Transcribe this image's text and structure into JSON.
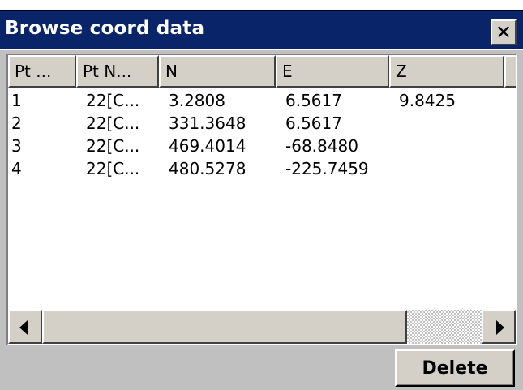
{
  "window": {
    "title": "Browse coord data",
    "close_glyph": "✕"
  },
  "table": {
    "columns": [
      "Pt ...",
      "Pt N...",
      "N",
      "E",
      "Z"
    ],
    "rows": [
      [
        "1",
        "22[C...",
        "3.2808",
        "6.5617",
        "9.8425"
      ],
      [
        "2",
        "22[C...",
        "331.3648",
        "6.5617",
        ""
      ],
      [
        "3",
        "22[C...",
        "469.4014",
        "-68.8480",
        ""
      ],
      [
        "4",
        "22[C...",
        "480.5278",
        "-225.7459",
        ""
      ]
    ]
  },
  "scrollbar": {
    "left_icon": "arrow-left-icon",
    "right_icon": "arrow-right-icon"
  },
  "buttons": {
    "delete_label": "Delete"
  },
  "colors": {
    "title_bar": "#0a246a",
    "face": "#d4d0c8",
    "background": "#c0c0c0"
  }
}
